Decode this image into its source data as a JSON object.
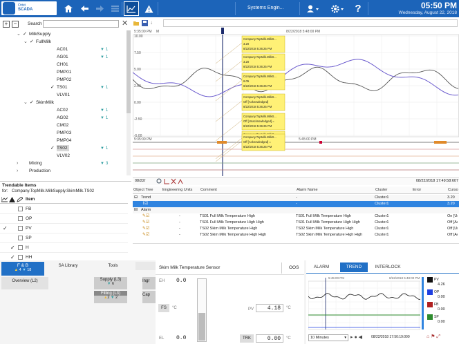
{
  "topbar": {
    "logo_line1": "Orbit",
    "logo_line2": "SCADA",
    "user_label": "Systems Engin...",
    "time": "05:50 PM",
    "date": "Wednesday, August 22, 2018",
    "colors": {
      "bar": "#1c64b9",
      "selected_row": "#2f84e0",
      "accent_teal": "#2f9da0"
    }
  },
  "left": {
    "search_label": "Search",
    "tree": [
      {
        "label": "MilkSupply",
        "depth": 1,
        "expander": "open",
        "checked": true,
        "badge": ""
      },
      {
        "label": "FullMilk",
        "depth": 2,
        "expander": "open",
        "checked": true,
        "badge": ""
      },
      {
        "label": "AC01",
        "depth": 3,
        "checked": false,
        "badge": "1"
      },
      {
        "label": "AG01",
        "depth": 3,
        "checked": false,
        "badge": "1"
      },
      {
        "label": "CH01",
        "depth": 3,
        "checked": false,
        "badge": ""
      },
      {
        "label": "PMP01",
        "depth": 3,
        "checked": false,
        "badge": ""
      },
      {
        "label": "PMP02",
        "depth": 3,
        "checked": false,
        "badge": ""
      },
      {
        "label": "TS01",
        "depth": 3,
        "checked": true,
        "badge": "1"
      },
      {
        "label": "VLV01",
        "depth": 3,
        "checked": false,
        "badge": ""
      },
      {
        "label": "SkimMilk",
        "depth": 2,
        "expander": "open",
        "checked": true,
        "badge": ""
      },
      {
        "label": "AC02",
        "depth": 3,
        "checked": false,
        "badge": "1"
      },
      {
        "label": "AG02",
        "depth": 3,
        "checked": false,
        "badge": "1"
      },
      {
        "label": "CM02",
        "depth": 3,
        "checked": false,
        "badge": ""
      },
      {
        "label": "PMP03",
        "depth": 3,
        "checked": false,
        "badge": ""
      },
      {
        "label": "PMP04",
        "depth": 3,
        "checked": false,
        "badge": ""
      },
      {
        "label": "TS02",
        "depth": 3,
        "checked": true,
        "badge": "1",
        "selected": true
      },
      {
        "label": "VLV02",
        "depth": 3,
        "checked": false,
        "badge": ""
      },
      {
        "label": "Mixing",
        "depth": 1,
        "expander": "closed",
        "checked": false,
        "badge": "3"
      },
      {
        "label": "Production",
        "depth": 1,
        "expander": "closed",
        "checked": false,
        "badge": ""
      }
    ],
    "trendable_title": "Trendable Items",
    "trendable_for_label": "for:",
    "trendable_for_value": "Company.TopMilk.MilkSupply.SkimMilk.TS02",
    "trendable_col_item": "Item",
    "trendable_items": [
      {
        "label": "FB",
        "col1": false,
        "col2": false
      },
      {
        "label": "OP",
        "col1": false,
        "col2": false
      },
      {
        "label": "PV",
        "col1": true,
        "col2": false
      },
      {
        "label": "SP",
        "col1": false,
        "col2": false
      },
      {
        "label": "H",
        "col1": false,
        "col2": true
      },
      {
        "label": "HH",
        "col1": false,
        "col2": true
      }
    ]
  },
  "chart": {
    "time_start": "5:35:00 PM",
    "time_end": "8/22/2018 5:48:00 PM",
    "time_lower_start": "5:35:00 PM",
    "time_lower_end": "5:45:00 PM",
    "marker": "M",
    "y_ticks": [
      "10.00",
      "7.50",
      "5.00",
      "2.50",
      "0.00",
      "-2.50",
      "-5.00"
    ],
    "footer_left_time": "08/22/",
    "footer_right_time": "08/22/2018 17:49:58:607",
    "annotations": [
      {
        "l1": "Company.TopMilk.MilkS...",
        "l2": "3.20",
        "l3": "8/22/2018 5:36:25 PM"
      },
      {
        "l1": "Company.TopMilk.MilkS...",
        "l2": "3.20",
        "l3": "8/22/2018 5:36:25 PM"
      },
      {
        "l1": "Company.TopMilk.MilkS...",
        "l2": "6.05",
        "l3": "8/22/2018 5:36:25 PM"
      },
      {
        "l1": "Company.TopMilk.MilkS...",
        "l2": "Off [Acknowledged]",
        "l3": "8/22/2018 5:36:25 PM"
      },
      {
        "l1": "Company.TopMilk.MilkS...",
        "l2": "Off [Unacknowledged] =",
        "l3": "8/22/2018 5:36:25 PM"
      },
      {
        "l1": "Company.TopMilk.MilkS...",
        "l2": "Off [Unacknowledged] =",
        "l3": "8/22/2018 5:36:25 PM"
      },
      {
        "l1": "Company.TopMilk.MilkS...",
        "l2": "Off [Acknowledged] =",
        "l3": "8/22/2018 5:36:25 PM"
      }
    ]
  },
  "grid": {
    "headers": [
      "Object Tree",
      "Engineering Units",
      "Comment",
      "Alarm Name",
      "Cluster",
      "Error",
      "Curso"
    ],
    "rows": [
      {
        "tree": "Trend",
        "eng": "",
        "comment": "",
        "alarm": "-",
        "cluster": "Cluster1",
        "error": "",
        "cursor": "3.20",
        "kind": "group"
      },
      {
        "tree": "",
        "eng": "",
        "comment": "",
        "alarm": "-",
        "cluster": "Cluster1",
        "error": "",
        "cursor": "3.20",
        "kind": "selected"
      },
      {
        "tree": "Alarm",
        "eng": "",
        "comment": "",
        "alarm": "",
        "cluster": "",
        "error": "",
        "cursor": "",
        "kind": "group"
      },
      {
        "tree": "",
        "eng": "-",
        "comment": "TS01 Full Milk Temperature High",
        "alarm": "TS01 Full Milk Temperature High",
        "cluster": "Cluster1",
        "error": "",
        "cursor": "On [Un",
        "kind": "row"
      },
      {
        "tree": "",
        "eng": "-",
        "comment": "TS01 Full Milk Temperature High High",
        "alarm": "TS01 Full Milk Temperature High High",
        "cluster": "Cluster1",
        "error": "",
        "cursor": "Off [Ac",
        "kind": "row"
      },
      {
        "tree": "",
        "eng": "-",
        "comment": "TS02 Skim Milk Temperature High",
        "alarm": "TS02 Skim Milk Temperature High",
        "cluster": "Cluster1",
        "error": "",
        "cursor": "Off [Ur",
        "kind": "row"
      },
      {
        "tree": "",
        "eng": "-",
        "comment": "TS02 Skim Milk Temperature High High",
        "alarm": "TS02 Skim Milk Temperature High High",
        "cluster": "Cluster1",
        "error": "",
        "cursor": "Off [Ac",
        "kind": "row"
      }
    ]
  },
  "bottom": {
    "tabs": [
      "F & B",
      "SA Library",
      "Tools"
    ],
    "fb_count_warn": "4",
    "fb_count_info": "18",
    "overview": "Overview (L2)",
    "supply": "Supply (L3)",
    "supply_count": "6",
    "ingr": "Ingr",
    "filling": "Filling (L3)",
    "filling_warn": "2",
    "filling_count": "2",
    "cap": "Cap",
    "sensor_title": "Skim Milk Temperature Sensor",
    "oos": "OOS",
    "eh_label": "EH",
    "eh_value": "0.0",
    "el_label": "EL",
    "el_value": "0.0",
    "fs_label": "FS",
    "unit": "°C",
    "pv_label": "PV",
    "pv_value": "4.18",
    "trk_label": "TRK",
    "trk_value": "0.00",
    "gauge_level": 0.45,
    "mini_tabs": [
      "ALARM",
      "TREND",
      "INTERLOCK"
    ],
    "mini_time_left": "5:45:00 PM",
    "mini_time_right": "8/22/2018 5:48:00 PM",
    "mini_range": "10 Minutes",
    "mini_footer_time": "08/22/2018 17:50:19:000",
    "legend": [
      {
        "code": "PV",
        "value": "4.26",
        "color": "#111111"
      },
      {
        "code": "OP",
        "value": "0.00",
        "color": "#1f3fe0"
      },
      {
        "code": "FB",
        "value": "0.00",
        "color": "#b02020"
      },
      {
        "code": "SP",
        "value": "0.00",
        "color": "#2e8b2e"
      }
    ]
  }
}
